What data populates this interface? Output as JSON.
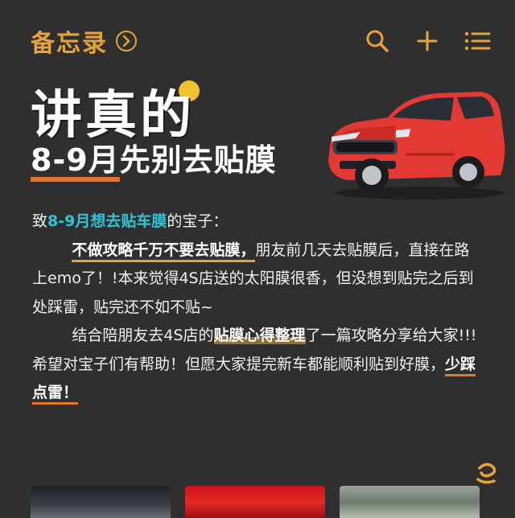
{
  "header": {
    "title": "备忘录",
    "icons": [
      "chevron-right-icon",
      "search-icon",
      "plus-icon",
      "list-icon"
    ]
  },
  "hero": {
    "line1": "讲真的",
    "line2_accent": "8-9月",
    "line2_rest": "先别去贴膜"
  },
  "body": {
    "p1_a": "致",
    "p1_highlight": "8-9月想去贴车膜",
    "p1_b": "的宝子：",
    "p2_highlight": "不做攻略千万不要去贴膜，",
    "p2_rest": "朋友前几天去贴膜后，直接在路上emo了！!本来觉得4S店送的太阳膜很香，但没想到贴完之后到处踩雷，贴完还不如不贴~",
    "p3_a": "结合陪朋友去4S店的",
    "p3_highlight": "贴膜心得整理",
    "p3_b": "了一篇攻略分享给大家!!!希望对宝子们有帮助！但愿大家提完新车都能顺利贴到好膜，",
    "p3_end": "少踩点雷！"
  },
  "colors": {
    "background": "#2f2f2f",
    "accent_orange": "#e6a33a",
    "accent_cyan": "#2ec4d6",
    "car_red": "#e23a32"
  }
}
